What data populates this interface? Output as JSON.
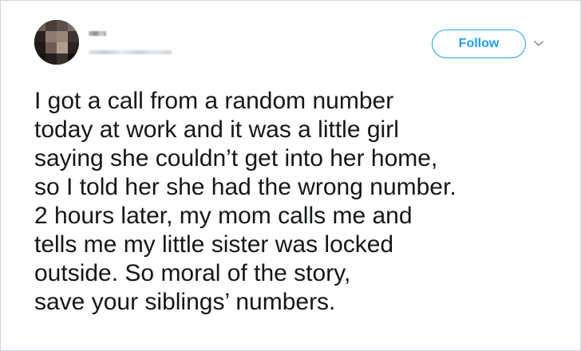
{
  "tweet": {
    "author_name": "Brie",
    "follow_label": "Follow",
    "caret_icon": "chevron-down-icon",
    "text_lines": [
      "I got a call from a random number",
      "today at work and it was a little girl",
      "saying she couldn’t get into her home,",
      "so I told her she had the wrong number.",
      "2 hours later, my mom calls me and",
      "tells me my little sister was locked",
      "outside. So moral of the story,",
      "save your siblings’ numbers."
    ]
  },
  "colors": {
    "accent": "#1da1f2",
    "text": "#14171a",
    "border": "#cfd6dc",
    "caret": "#8899a6"
  }
}
